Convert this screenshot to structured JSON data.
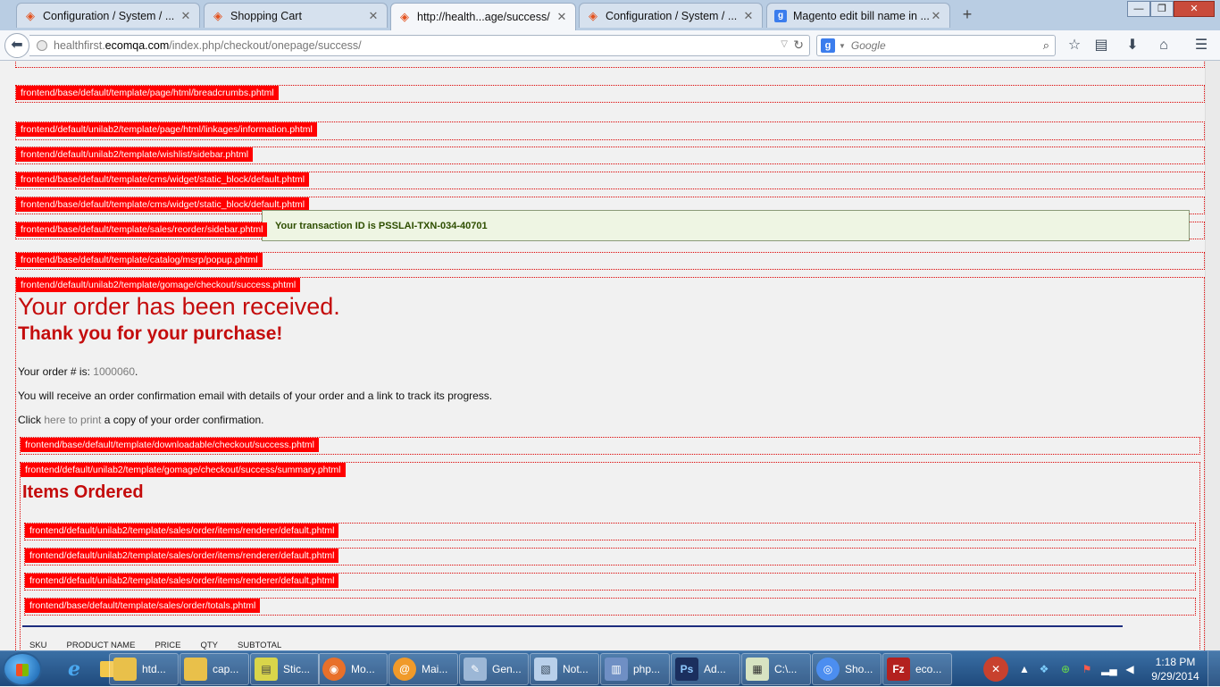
{
  "browser": {
    "tabs": [
      {
        "label": "Configuration / System / ...",
        "icon": "magento-icon",
        "active": false
      },
      {
        "label": "Shopping Cart",
        "icon": "magento-icon",
        "active": false
      },
      {
        "label": "http://health...age/success/",
        "icon": "magento-icon",
        "active": true
      },
      {
        "label": "Configuration / System / ...",
        "icon": "magento-icon",
        "active": false
      },
      {
        "label": "Magento edit bill name in ...",
        "icon": "google-icon",
        "active": false
      }
    ],
    "new_tab": "+",
    "url": {
      "prefix": "healthfirst.",
      "host": "ecomqa.com",
      "path": "/index.php/checkout/onepage/success/"
    },
    "search_placeholder": "Google",
    "window_buttons": {
      "minimize": "—",
      "maximize": "❐",
      "close": "✕"
    }
  },
  "page": {
    "template_hints": [
      "frontend/base/default/template/page/html/breadcrumbs.phtml",
      "frontend/default/unilab2/template/page/html/linkages/information.phtml",
      "frontend/default/unilab2/template/wishlist/sidebar.phtml",
      "frontend/base/default/template/cms/widget/static_block/default.phtml",
      "frontend/base/default/template/cms/widget/static_block/default.phtml",
      "frontend/base/default/template/sales/reorder/sidebar.phtml",
      "frontend/base/default/template/catalog/msrp/popup.phtml",
      "frontend/default/unilab2/template/gomage/checkout/success.phtml",
      "frontend/base/default/template/downloadable/checkout/success.phtml",
      "frontend/default/unilab2/template/gomage/checkout/success/summary.phtml",
      "frontend/default/unilab2/template/sales/order/items/renderer/default.phtml",
      "frontend/default/unilab2/template/sales/order/items/renderer/default.phtml",
      "frontend/default/unilab2/template/sales/order/items/renderer/default.phtml",
      "frontend/base/default/template/sales/order/totals.phtml"
    ],
    "transaction_message": "Your transaction ID is PSSLAI-TXN-034-40701",
    "order_title": "Your order has been received.",
    "thank_you": "Thank you for your purchase!",
    "order_number_label": "Your order # is: ",
    "order_number": "1000060",
    "order_number_suffix": ".",
    "confirmation_text": "You will receive an order confirmation email with details of your order and a link to track its progress.",
    "print_prefix": "Click ",
    "print_link": "here to print",
    "print_suffix": " a copy of your order confirmation.",
    "items_title": "Items Ordered",
    "table_headers": [
      "SKU",
      "PRODUCT NAME",
      "PRICE",
      "QTY",
      "SUBTOTAL"
    ]
  },
  "taskbar": {
    "pinned": [
      {
        "name": "internet-explorer-icon",
        "glyph": "e",
        "color": "#4aa8f0"
      },
      {
        "name": "folder-icon",
        "glyph": "▮",
        "color": "#f3c74a"
      }
    ],
    "items": [
      {
        "label": "htd...",
        "icon": "folder-icon",
        "color": "#e9c04a",
        "glyph": "▮"
      },
      {
        "label": "cap...",
        "icon": "folder-icon",
        "color": "#e9c04a",
        "glyph": "▮"
      },
      {
        "label": "Stic...",
        "icon": "sticky-notes-icon",
        "color": "#d9d54a",
        "glyph": "▤"
      },
      {
        "label": "Mo...",
        "icon": "firefox-icon",
        "color": "#e8702a",
        "glyph": "◉"
      },
      {
        "label": "Mai...",
        "icon": "mail-icon",
        "color": "#f09a2a",
        "glyph": "@"
      },
      {
        "label": "Gen...",
        "icon": "generator-icon",
        "color": "#9cb7d6",
        "glyph": "✎"
      },
      {
        "label": "Not...",
        "icon": "notepad-icon",
        "color": "#b9d0ea",
        "glyph": "▧"
      },
      {
        "label": "php...",
        "icon": "php-editor-icon",
        "color": "#6f8fc4",
        "glyph": "▥"
      },
      {
        "label": "Ad...",
        "icon": "photoshop-icon",
        "color": "#1b2f5e",
        "glyph": "Ps"
      },
      {
        "label": "C:\\...",
        "icon": "cmd-icon",
        "color": "#d7e3c2",
        "glyph": "▦"
      },
      {
        "label": "Sho...",
        "icon": "chrome-icon",
        "color": "#4c8ef0",
        "glyph": "◎"
      },
      {
        "label": "eco...",
        "icon": "filezilla-icon",
        "color": "#b3211f",
        "glyph": "Fz"
      }
    ],
    "tray_icons": [
      "network-warning-icon",
      "chevron-up-icon",
      "dropbox-icon",
      "plus-icon",
      "flag-icon",
      "signal-icon",
      "volume-icon"
    ],
    "clock_time": "1:18 PM",
    "clock_date": "9/29/2014"
  }
}
